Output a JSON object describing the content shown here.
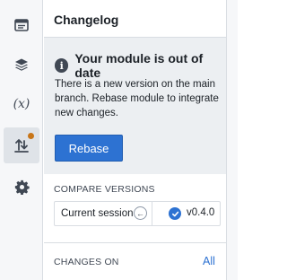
{
  "rail": {
    "items": [
      {
        "name": "panel",
        "icon": "panel-icon"
      },
      {
        "name": "layers",
        "icon": "layers-icon"
      },
      {
        "name": "variables",
        "icon": "variable-icon",
        "label": "(x)"
      },
      {
        "name": "changelog",
        "icon": "changes-icon",
        "active": true,
        "badge": "orange-dot"
      },
      {
        "name": "settings",
        "icon": "gear-icon"
      }
    ]
  },
  "panel": {
    "title": "Changelog",
    "callout": {
      "title": "Your module is out of date",
      "body": "There is a new version on the main branch. Rebase module to integrate new changes.",
      "button": "Rebase"
    },
    "compare": {
      "label": "COMPARE VERSIONS",
      "current": "Current session",
      "version": "v0.4.0"
    },
    "changes": {
      "label": "CHANGES ON",
      "filter": "All"
    }
  },
  "colors": {
    "accent": "#2d72d2",
    "badge": "#c87619",
    "callout_bg": "#eceff2",
    "rail_bg": "#f6f7f9"
  }
}
